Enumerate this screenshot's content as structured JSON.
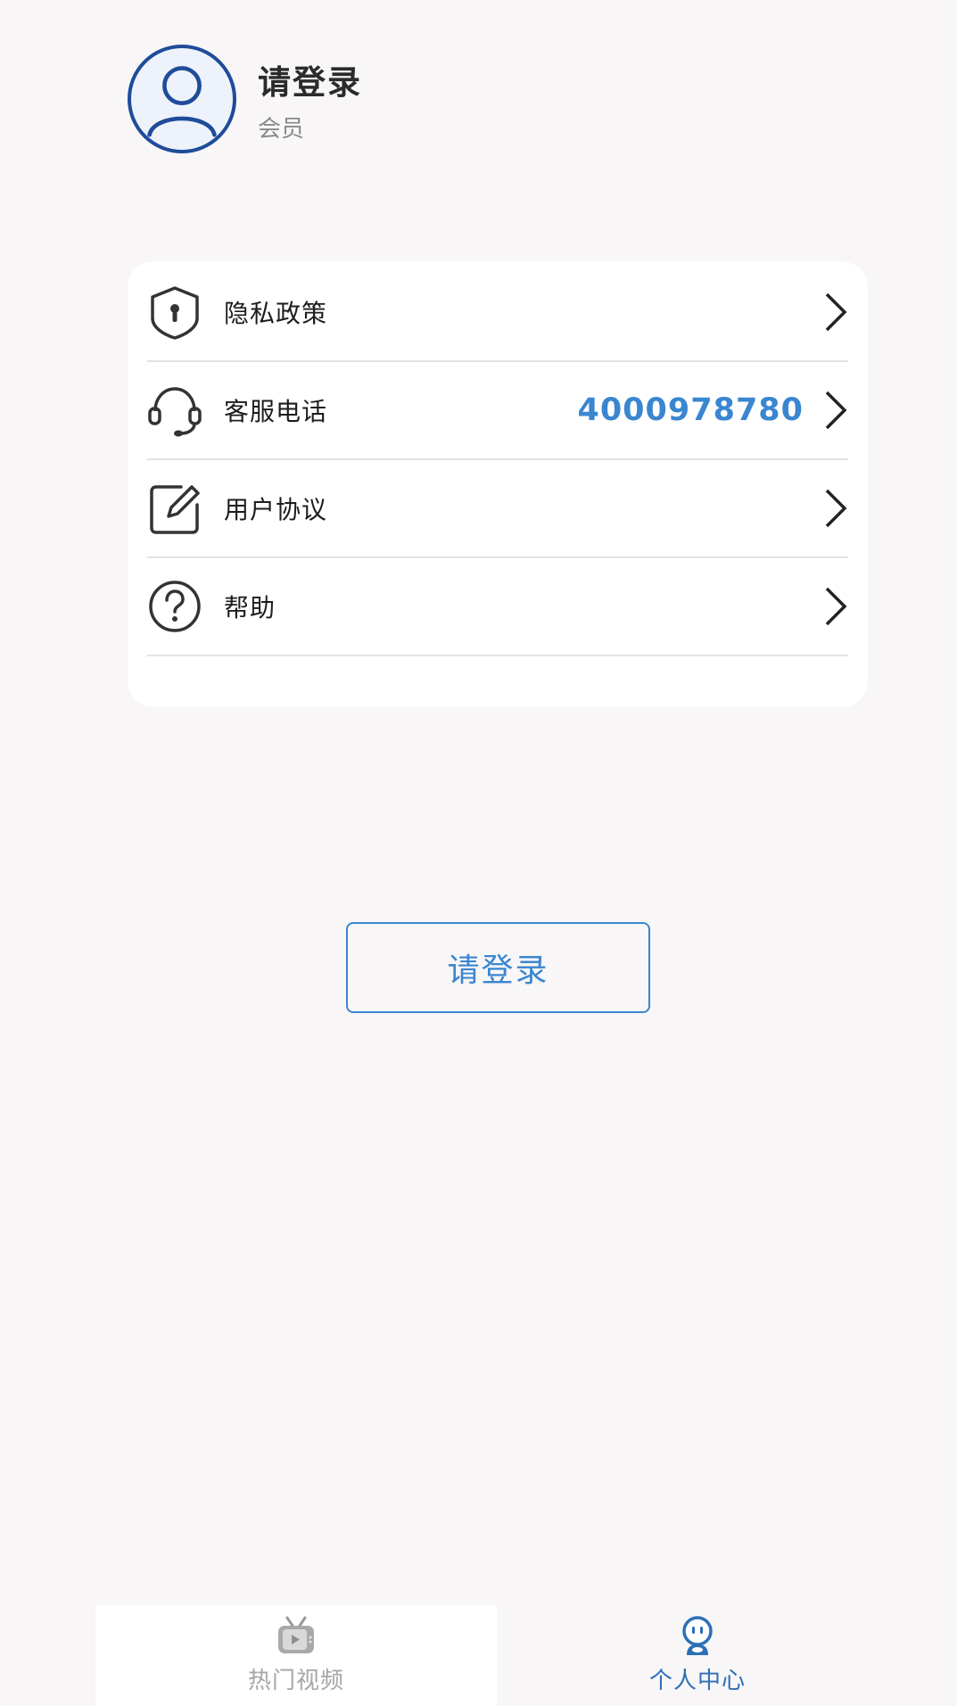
{
  "profile": {
    "name": "请登录",
    "member_label": "会员"
  },
  "menu": {
    "items": [
      {
        "label": "隐私政策",
        "icon": "shield-lock-icon",
        "value": ""
      },
      {
        "label": "客服电话",
        "icon": "headset-icon",
        "value": "4000978780"
      },
      {
        "label": "用户协议",
        "icon": "edit-document-icon",
        "value": ""
      },
      {
        "label": "帮助",
        "icon": "help-circle-icon",
        "value": ""
      }
    ]
  },
  "login_button": {
    "label": "请登录"
  },
  "tabbar": {
    "tabs": [
      {
        "label": "热门视频",
        "icon": "tv-icon",
        "active": false
      },
      {
        "label": "个人中心",
        "icon": "robot-person-icon",
        "active": true
      }
    ]
  },
  "colors": {
    "accent": "#3a86d0",
    "avatar_border": "#1f4c9a",
    "background": "#f8f6f7",
    "card": "#ffffff"
  }
}
